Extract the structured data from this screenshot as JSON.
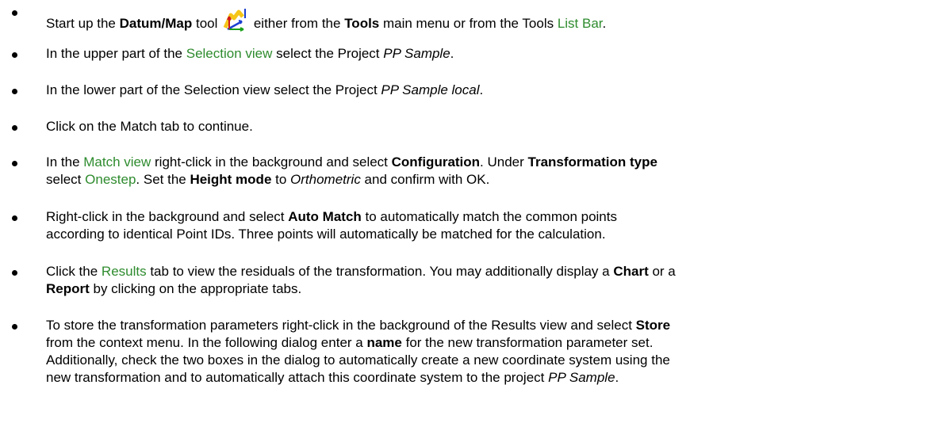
{
  "steps": [
    {
      "pre": "Start up the ",
      "tool_name": "Datum/Map",
      "mid1": " tool",
      "tool_icon": "datum-map-tool-icon",
      "mid2": " either from the ",
      "menu_name": "Tools",
      "mid3": " main menu or from the Tools ",
      "link": "List Bar",
      "post": "."
    },
    {
      "pre": "In the upper part of the ",
      "link": "Selection view",
      "mid": " select the Project ",
      "project": "PP Sample",
      "post": "."
    },
    {
      "pre": "In the lower part of the Selection view select the Project ",
      "project": "PP Sample local",
      "post": "."
    },
    {
      "text": "Click on the Match tab to continue."
    },
    {
      "pre": "In the ",
      "link1": "Match view",
      "mid1": " right-click in the background and select ",
      "b1": "Configuration",
      "mid2": ". Under ",
      "b2": "Transformation type",
      "line2_pre": "select ",
      "link2": "Onestep",
      "mid3": ". Set the ",
      "b3": "Height mode",
      "mid4": " to ",
      "i1": "Orthometric",
      "post": " and confirm with OK."
    },
    {
      "pre": "Right-click in the background and select ",
      "b1": "Auto Match",
      "mid1": " to automatically match the common points",
      "line2": "according to identical Point IDs. Three points will automatically be matched for the calculation."
    },
    {
      "pre": "Click the ",
      "link": "Results",
      "mid1": " tab to view the residuals of the transformation. You may additionally display a ",
      "b1": "Chart",
      "mid2": " or a",
      "b2": "Report",
      "post": " by clicking on the appropriate tabs."
    },
    {
      "pre": "To store the transformation parameters right-click in the background of the Results view and select ",
      "b1": "Store",
      "line2_pre": "from the context menu. In the following dialog enter a ",
      "b2": "name",
      "line2_post": " for the new transformation parameter set.",
      "line3": "Additionally, check the two boxes in the dialog to automatically create a new coordinate system using the",
      "line4_pre": "new transformation and to automatically attach this coordinate system to the project ",
      "project": "PP Sample",
      "post": "."
    }
  ],
  "colors": {
    "text": "#000000",
    "link": "#2e8b2e"
  }
}
